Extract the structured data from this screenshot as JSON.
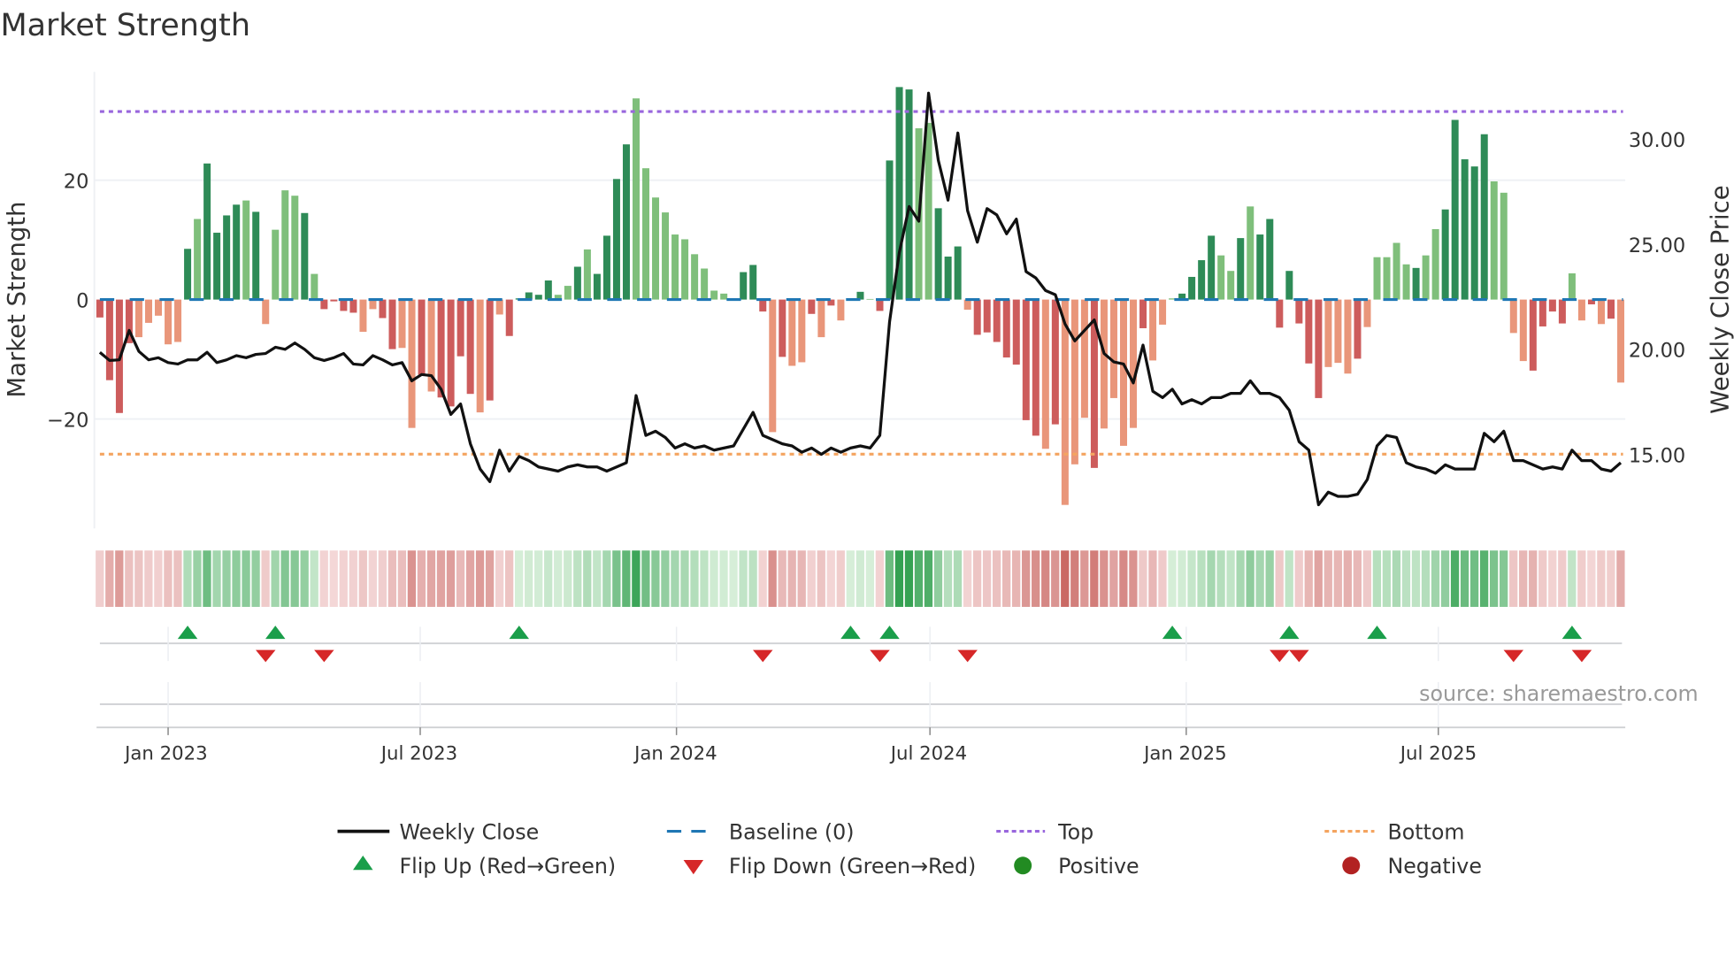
{
  "chart_data": {
    "type": "bar",
    "title": "Market Strength",
    "ylabel": "Market Strength",
    "y2label": "Weekly Close Price",
    "ylim": [
      -38.3,
      38.1
    ],
    "y2lim": [
      11.5,
      33.2
    ],
    "yticks_left": [
      "20",
      "0",
      "−20"
    ],
    "yticks_left_values": [
      20,
      0,
      -20
    ],
    "yticks_right": [
      "30.00",
      "25.00",
      "20.00",
      "15.00"
    ],
    "yticks_right_values": [
      30,
      25,
      20,
      15
    ],
    "xticks": [
      "Jan 2023",
      "Jul 2023",
      "Jan 2024",
      "Jul 2024",
      "Jan 2025",
      "Jul 2025"
    ],
    "xtick_dates": [
      "2023-01-01",
      "2023-07-01",
      "2024-01-01",
      "2024-07-01",
      "2025-01-01",
      "2025-07-01"
    ],
    "x_start_week": "2022-11-13",
    "x_interval_days": 7,
    "grid": true,
    "top_threshold": 31.5,
    "bottom_threshold": -25.9,
    "baseline": 0,
    "strength": [
      -3.0,
      -13.5,
      -19,
      -7.3,
      -6.3,
      -3.9,
      -2.7,
      -7.5,
      -7.1,
      8.5,
      13.5,
      22.8,
      11.2,
      14.1,
      15.9,
      16.6,
      14.7,
      -4.1,
      11.7,
      18.3,
      17.4,
      14.5,
      4.3,
      -1.6,
      -0.3,
      -1.9,
      -2.2,
      -5.4,
      -1.6,
      -3.1,
      -8.3,
      -8.1,
      -21.5,
      -12.6,
      -15.4,
      -16.4,
      -17.9,
      -9.5,
      -15.8,
      -18.9,
      -16.9,
      -2.5,
      -6.1,
      0.2,
      1.2,
      0.8,
      3.2,
      0.8,
      2.3,
      5.5,
      8.4,
      4.3,
      10.7,
      20.2,
      26.0,
      33.7,
      22.0,
      17.1,
      14.6,
      10.9,
      10.1,
      7.6,
      5.2,
      1.5,
      1.0,
      0.1,
      4.6,
      5.8,
      -2.0,
      -22.2,
      -9.6,
      -11.1,
      -10.5,
      -2.4,
      -6.3,
      -1.0,
      -3.5,
      0.1,
      1.3,
      0.1,
      -1.9,
      23.3,
      35.6,
      35.2,
      28.7,
      29.6,
      15.3,
      7.2,
      8.9,
      -1.7,
      -5.9,
      -5.5,
      -7.1,
      -9.7,
      -10.9,
      -20.2,
      -22.8,
      -25,
      -20.9,
      -34.4,
      -27.6,
      -19.8,
      -28.2,
      -21.6,
      -16.5,
      -24.5,
      -21.5,
      -4.8,
      -10.2,
      -4.2,
      0.2,
      1.0,
      3.8,
      6.6,
      10.7,
      7.4,
      4.8,
      10.3,
      15.6,
      10.9,
      13.5,
      -4.7,
      4.8,
      -4.0,
      -10.7,
      -16.5,
      -11.3,
      -10.6,
      -12.4,
      -9.9,
      -4.6,
      7.1,
      7.1,
      9.5,
      5.9,
      5.3,
      7.4,
      11.8,
      15.1,
      30.1,
      23.5,
      22.3,
      27.7,
      19.8,
      17.9,
      -5.6,
      -10.3,
      -11.9,
      -4.5,
      -2.0,
      -4.0,
      4.4,
      -3.5,
      -0.8,
      -4.1,
      -3.2,
      -13.9
    ],
    "strength_style": "ddddllllldlddddldlllldlddddllddlldlddddldldddddlldlddddllllllllllddddldlldldlddlddddlldddldddddddldllldlllldlllddddlldldddddddllldllllldlldddddllllddddlldldlll",
    "weekly_close": [
      19.86,
      19.47,
      19.5,
      20.9,
      19.9,
      19.5,
      19.6,
      19.37,
      19.3,
      19.5,
      19.5,
      19.86,
      19.37,
      19.5,
      19.7,
      19.6,
      19.76,
      19.8,
      20.1,
      20.0,
      20.3,
      20.0,
      19.6,
      19.47,
      19.6,
      19.8,
      19.3,
      19.26,
      19.7,
      19.5,
      19.26,
      19.37,
      18.5,
      18.8,
      18.75,
      18.1,
      16.9,
      17.4,
      15.5,
      14.3,
      13.7,
      15.2,
      14.2,
      14.9,
      14.7,
      14.4,
      14.3,
      14.2,
      14.4,
      14.5,
      14.4,
      14.4,
      14.2,
      14.4,
      14.6,
      17.8,
      15.9,
      16.1,
      15.8,
      15.3,
      15.5,
      15.3,
      15.4,
      15.2,
      15.3,
      15.4,
      16.2,
      17.0,
      15.9,
      15.7,
      15.5,
      15.4,
      15.1,
      15.3,
      15.0,
      15.3,
      15.1,
      15.3,
      15.4,
      15.3,
      15.9,
      21.3,
      24.6,
      26.8,
      26.1,
      32.2,
      29.0,
      27.1,
      30.3,
      26.6,
      25.1,
      26.7,
      26.4,
      25.5,
      26.2,
      23.7,
      23.4,
      22.8,
      22.6,
      21.2,
      20.4,
      20.9,
      21.4,
      19.8,
      19.4,
      19.3,
      18.4,
      20.2,
      18.0,
      17.7,
      18.1,
      17.4,
      17.6,
      17.4,
      17.7,
      17.7,
      17.9,
      17.9,
      18.5,
      17.9,
      17.9,
      17.7,
      17.1,
      15.6,
      15.2,
      12.6,
      13.2,
      13.0,
      13.0,
      13.1,
      13.8,
      15.4,
      15.9,
      15.8,
      14.6,
      14.4,
      14.3,
      14.1,
      14.5,
      14.3,
      14.3,
      14.3,
      16.0,
      15.6,
      16.1,
      14.7,
      14.7,
      14.5,
      14.3,
      14.4,
      14.3,
      15.2,
      14.7,
      14.7,
      14.3,
      14.2,
      14.6
    ],
    "legend": {
      "placement": "bottom",
      "items": [
        {
          "label": "Weekly Close",
          "symbol": "line"
        },
        {
          "label": "Baseline (0)",
          "symbol": "dashed"
        },
        {
          "label": "Top",
          "symbol": "dotted-purple"
        },
        {
          "label": "Bottom",
          "symbol": "dotted-orange"
        },
        {
          "label": "Flip Up (Red→Green)",
          "symbol": "triangle-up"
        },
        {
          "label": "Flip Down (Green→Red)",
          "symbol": "triangle-down"
        },
        {
          "label": "Positive",
          "symbol": "dot-green"
        },
        {
          "label": "Negative",
          "symbol": "dot-red"
        }
      ]
    },
    "source": "source: sharemaestro.com"
  },
  "colors": {
    "strong_pos": "#2e8b57",
    "weak_pos": "#7fbf7b",
    "strong_neg": "#cd5c5c",
    "weak_neg": "#e9967a",
    "line": "#111111",
    "baseline": "#1f77b4",
    "top": "#9966dd",
    "bottom": "#f4a460",
    "flip_up": "#1a9e4a",
    "flip_down": "#d62728",
    "positive": "#228b22",
    "negative": "#b22222"
  }
}
